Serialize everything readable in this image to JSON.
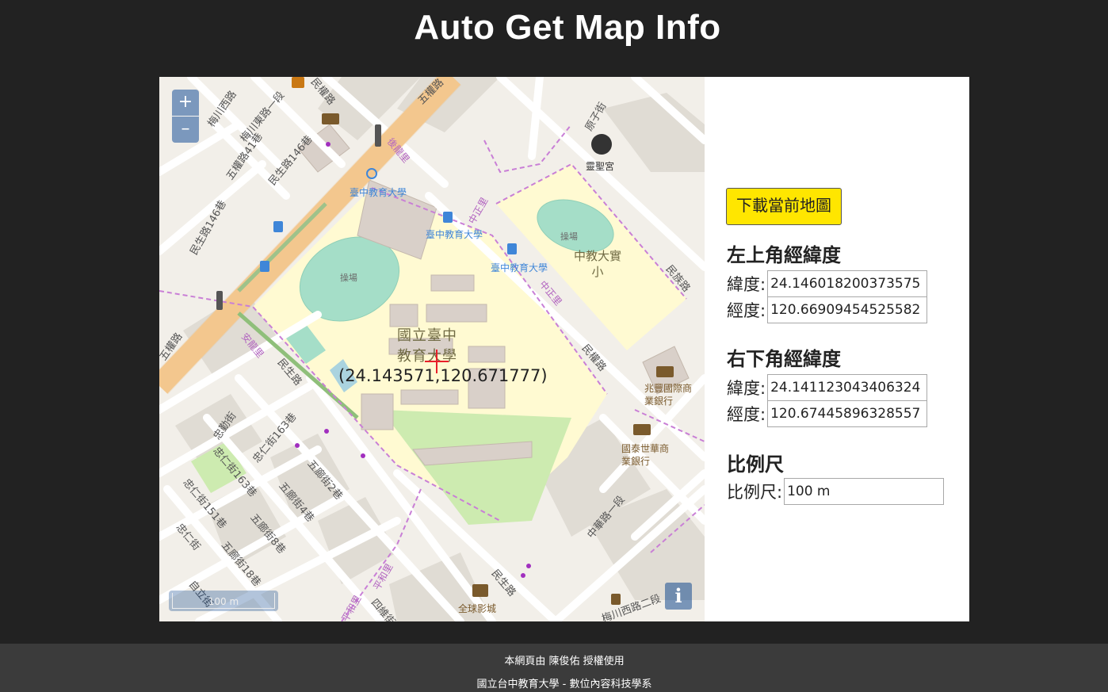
{
  "page": {
    "title": "Auto Get Map Info"
  },
  "map": {
    "zoom_in": "+",
    "zoom_out": "–",
    "scale_label": "100 m",
    "attribution_icon": "i",
    "center_coord": "(24.143571,120.671777)",
    "labels": {
      "meichuan_west": "梅川西路",
      "meichuan_east": "梅川東路一段",
      "minquan_top": "民權路",
      "wuquan_top": "五權路",
      "wuquan_41": "五權路41巷",
      "minsheng_146": "民生路146巷",
      "minsheng_146b": "民生路146巷",
      "wuquan_left": "五權路",
      "bike_station": "臺中教育大學",
      "bus1": "臺中教育大學",
      "bus2": "臺中教育大學",
      "field1": "操場",
      "field2": "操場",
      "school_name": "國立臺中教育大學",
      "elem_school": "中教大實小",
      "temple": "靈聖宮",
      "yuanzi": "原子街",
      "zhongzheng1": "中正里",
      "zhongzheng2": "中正里",
      "houlong": "後龍里",
      "anlong": "安龍里",
      "minzu": "民族路",
      "minquan_right": "民權路",
      "minsheng_left": "民生路",
      "minsheng_bottom": "民生路",
      "bank1": "兆豐國際商業銀行",
      "bank2": "國泰世華商業銀行",
      "zhonghua": "中華路一段",
      "shiqin": "忠勤街",
      "zhongxiao163": "忠仁街163巷",
      "zhongren163": "忠仁街163巷",
      "zhongren151": "忠仁街151巷",
      "zhongren": "忠仁街",
      "wulang2": "五廊街2巷",
      "wulang4": "五廊街4巷",
      "wulang8": "五廊街8巷",
      "wulang18": "五廊街18巷",
      "ziyou": "自立街",
      "pinghe1": "平和里",
      "pinghe2": "平和里",
      "siwei": "四維街",
      "cinema": "全球影城",
      "meichuan_west2": "梅川西路二段"
    }
  },
  "panel": {
    "download_button": "下載當前地圖",
    "top_left": {
      "title": "左上角經緯度",
      "lat_label": "緯度:",
      "lat_value": "24.146018200373575",
      "lng_label": "經度:",
      "lng_value": "120.66909454525582"
    },
    "bottom_right": {
      "title": "右下角經緯度",
      "lat_label": "緯度:",
      "lat_value": "24.141123043406324",
      "lng_label": "經度:",
      "lng_value": "120.67445896328557"
    },
    "scale": {
      "title": "比例尺",
      "label": "比例尺:",
      "value": "100 m"
    }
  },
  "footer": {
    "line1": "本網頁由 陳俊佑 授權使用",
    "line2": "國立台中教育大學 - 數位內容科技學系"
  },
  "colors": {
    "background": "#222222",
    "footer": "#3b3b3b",
    "download_button": "#ffe600",
    "map_control": "#003c88",
    "campus": "#fffad2",
    "field": "#a5dec8",
    "major_road": "#f7cd95"
  }
}
